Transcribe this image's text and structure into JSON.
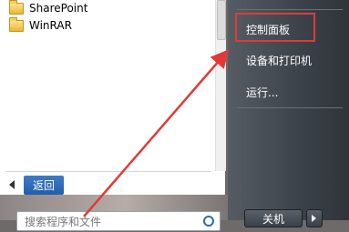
{
  "programs": [
    {
      "label": "SharePoint",
      "icon": "folder-icon"
    },
    {
      "label": "WinRAR",
      "icon": "folder-icon"
    }
  ],
  "back": {
    "label": "返回"
  },
  "search": {
    "placeholder": "搜索程序和文件"
  },
  "right_menu": {
    "control_panel": "控制面板",
    "devices_printers": "设备和打印机",
    "run": "运行..."
  },
  "shutdown": {
    "label": "关机"
  },
  "colors": {
    "annotation": "#e13a36",
    "back_highlight": "#235da8"
  }
}
